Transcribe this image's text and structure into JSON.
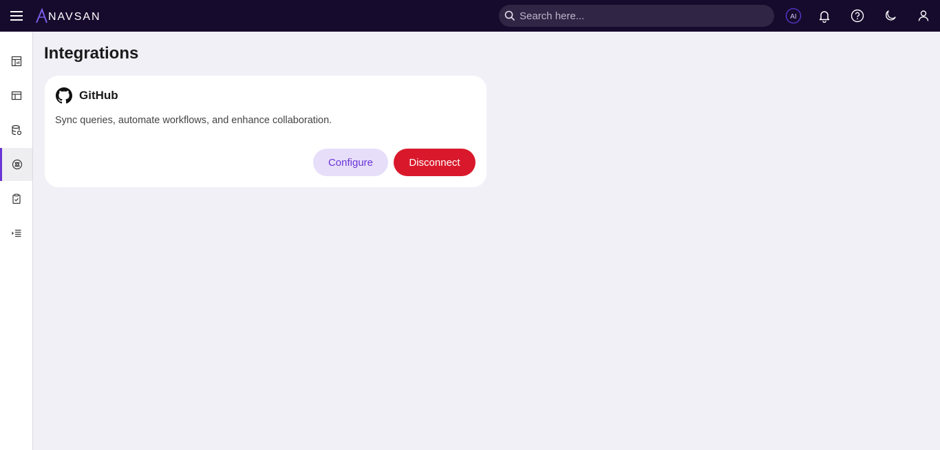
{
  "header": {
    "logo_text": "NAVSAN",
    "search_placeholder": "Search here...",
    "ai_label": "AI",
    "icons": [
      "menu-icon",
      "search-icon",
      "ai-icon",
      "bell-icon",
      "help-icon",
      "moon-icon",
      "user-icon"
    ]
  },
  "sidebar": {
    "items": [
      {
        "icon": "dashboard-icon"
      },
      {
        "icon": "layout-icon"
      },
      {
        "icon": "database-icon"
      },
      {
        "icon": "integrations-icon",
        "active": true
      },
      {
        "icon": "clipboard-check-icon"
      },
      {
        "icon": "list-indent-icon"
      }
    ]
  },
  "main": {
    "title": "Integrations",
    "cards": [
      {
        "icon": "github-icon",
        "title": "GitHub",
        "description": "Sync queries, automate workflows, and enhance collaboration.",
        "configure_label": "Configure",
        "disconnect_label": "Disconnect"
      }
    ]
  },
  "colors": {
    "topbar": "#170b2d",
    "accent": "#6a34d6",
    "danger": "#d9192b",
    "background": "#f2f0f7"
  }
}
